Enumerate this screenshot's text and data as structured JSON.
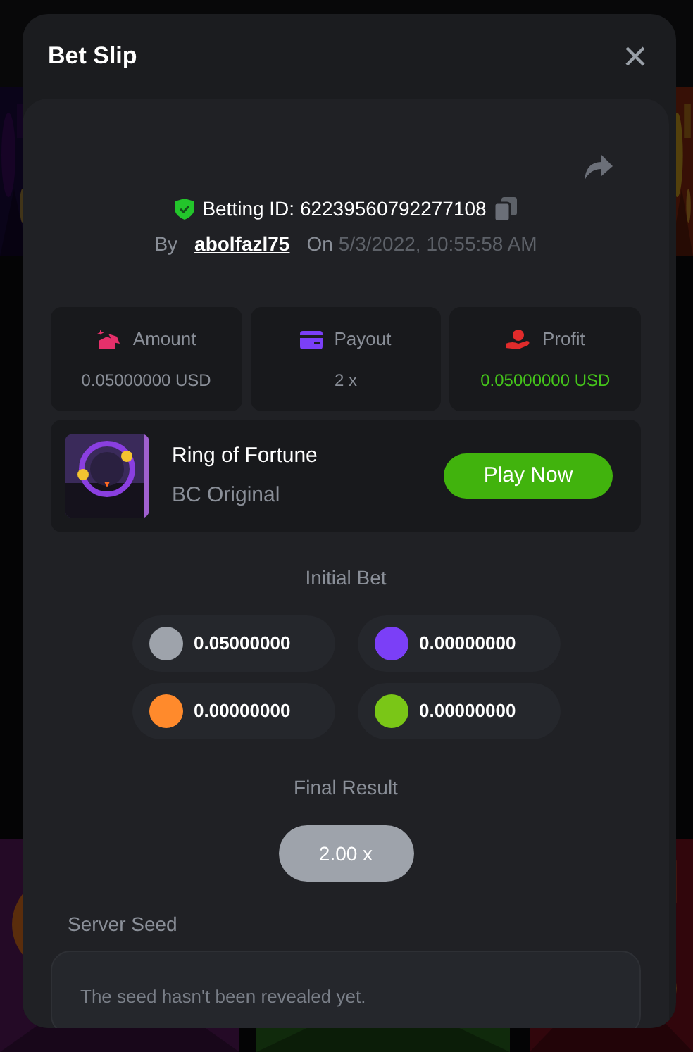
{
  "modal": {
    "title": "Bet Slip"
  },
  "bet": {
    "id_label": "Betting ID: 62239560792277108",
    "by_label": "By",
    "user": "abolfazl75",
    "on_label": "On",
    "date": "5/3/2022, 10:55:58 AM"
  },
  "stats": [
    {
      "kind": "amount",
      "label": "Amount",
      "value": "0.05000000 USD",
      "positive": false
    },
    {
      "kind": "payout",
      "label": "Payout",
      "value": "2 x",
      "positive": false
    },
    {
      "kind": "profit",
      "label": "Profit",
      "value": "0.05000000 USD",
      "positive": true
    }
  ],
  "game": {
    "name": "Ring of Fortune",
    "provider": "BC Original",
    "button": "Play Now"
  },
  "initial_bet": {
    "title": "Initial Bet",
    "chips": [
      {
        "color": "#9ea3ab",
        "value": "0.05000000"
      },
      {
        "color": "#7b3ff7",
        "value": "0.00000000"
      },
      {
        "color": "#ff8a2c",
        "value": "0.00000000"
      },
      {
        "color": "#7ac617",
        "value": "0.00000000"
      }
    ]
  },
  "final_result": {
    "title": "Final Result",
    "value": "2.00 x"
  },
  "server_seed": {
    "label": "Server Seed",
    "value": "The seed hasn't been revealed yet."
  }
}
